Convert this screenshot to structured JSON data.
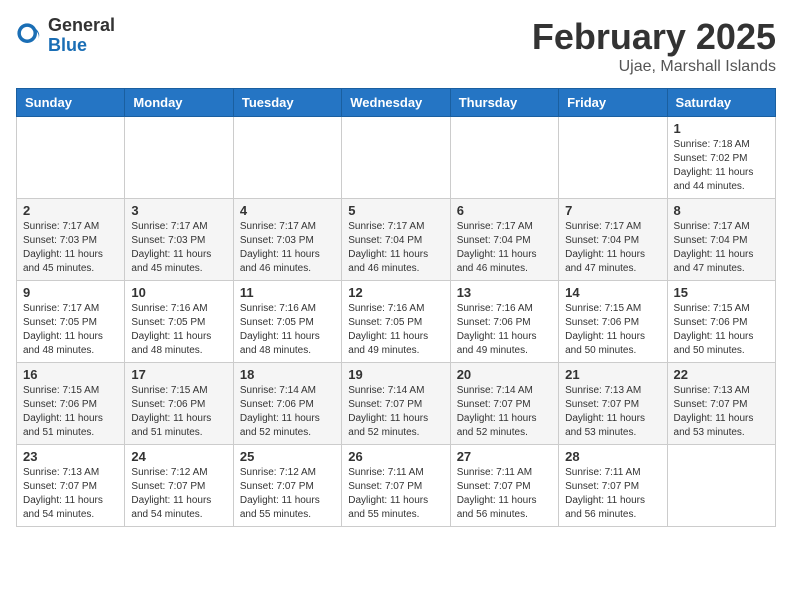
{
  "logo": {
    "general": "General",
    "blue": "Blue"
  },
  "title": "February 2025",
  "location": "Ujae, Marshall Islands",
  "days_of_week": [
    "Sunday",
    "Monday",
    "Tuesday",
    "Wednesday",
    "Thursday",
    "Friday",
    "Saturday"
  ],
  "weeks": [
    [
      {
        "day": "",
        "info": ""
      },
      {
        "day": "",
        "info": ""
      },
      {
        "day": "",
        "info": ""
      },
      {
        "day": "",
        "info": ""
      },
      {
        "day": "",
        "info": ""
      },
      {
        "day": "",
        "info": ""
      },
      {
        "day": "1",
        "info": "Sunrise: 7:18 AM\nSunset: 7:02 PM\nDaylight: 11 hours\nand 44 minutes."
      }
    ],
    [
      {
        "day": "2",
        "info": "Sunrise: 7:17 AM\nSunset: 7:03 PM\nDaylight: 11 hours\nand 45 minutes."
      },
      {
        "day": "3",
        "info": "Sunrise: 7:17 AM\nSunset: 7:03 PM\nDaylight: 11 hours\nand 45 minutes."
      },
      {
        "day": "4",
        "info": "Sunrise: 7:17 AM\nSunset: 7:03 PM\nDaylight: 11 hours\nand 46 minutes."
      },
      {
        "day": "5",
        "info": "Sunrise: 7:17 AM\nSunset: 7:04 PM\nDaylight: 11 hours\nand 46 minutes."
      },
      {
        "day": "6",
        "info": "Sunrise: 7:17 AM\nSunset: 7:04 PM\nDaylight: 11 hours\nand 46 minutes."
      },
      {
        "day": "7",
        "info": "Sunrise: 7:17 AM\nSunset: 7:04 PM\nDaylight: 11 hours\nand 47 minutes."
      },
      {
        "day": "8",
        "info": "Sunrise: 7:17 AM\nSunset: 7:04 PM\nDaylight: 11 hours\nand 47 minutes."
      }
    ],
    [
      {
        "day": "9",
        "info": "Sunrise: 7:17 AM\nSunset: 7:05 PM\nDaylight: 11 hours\nand 48 minutes."
      },
      {
        "day": "10",
        "info": "Sunrise: 7:16 AM\nSunset: 7:05 PM\nDaylight: 11 hours\nand 48 minutes."
      },
      {
        "day": "11",
        "info": "Sunrise: 7:16 AM\nSunset: 7:05 PM\nDaylight: 11 hours\nand 48 minutes."
      },
      {
        "day": "12",
        "info": "Sunrise: 7:16 AM\nSunset: 7:05 PM\nDaylight: 11 hours\nand 49 minutes."
      },
      {
        "day": "13",
        "info": "Sunrise: 7:16 AM\nSunset: 7:06 PM\nDaylight: 11 hours\nand 49 minutes."
      },
      {
        "day": "14",
        "info": "Sunrise: 7:15 AM\nSunset: 7:06 PM\nDaylight: 11 hours\nand 50 minutes."
      },
      {
        "day": "15",
        "info": "Sunrise: 7:15 AM\nSunset: 7:06 PM\nDaylight: 11 hours\nand 50 minutes."
      }
    ],
    [
      {
        "day": "16",
        "info": "Sunrise: 7:15 AM\nSunset: 7:06 PM\nDaylight: 11 hours\nand 51 minutes."
      },
      {
        "day": "17",
        "info": "Sunrise: 7:15 AM\nSunset: 7:06 PM\nDaylight: 11 hours\nand 51 minutes."
      },
      {
        "day": "18",
        "info": "Sunrise: 7:14 AM\nSunset: 7:06 PM\nDaylight: 11 hours\nand 52 minutes."
      },
      {
        "day": "19",
        "info": "Sunrise: 7:14 AM\nSunset: 7:07 PM\nDaylight: 11 hours\nand 52 minutes."
      },
      {
        "day": "20",
        "info": "Sunrise: 7:14 AM\nSunset: 7:07 PM\nDaylight: 11 hours\nand 52 minutes."
      },
      {
        "day": "21",
        "info": "Sunrise: 7:13 AM\nSunset: 7:07 PM\nDaylight: 11 hours\nand 53 minutes."
      },
      {
        "day": "22",
        "info": "Sunrise: 7:13 AM\nSunset: 7:07 PM\nDaylight: 11 hours\nand 53 minutes."
      }
    ],
    [
      {
        "day": "23",
        "info": "Sunrise: 7:13 AM\nSunset: 7:07 PM\nDaylight: 11 hours\nand 54 minutes."
      },
      {
        "day": "24",
        "info": "Sunrise: 7:12 AM\nSunset: 7:07 PM\nDaylight: 11 hours\nand 54 minutes."
      },
      {
        "day": "25",
        "info": "Sunrise: 7:12 AM\nSunset: 7:07 PM\nDaylight: 11 hours\nand 55 minutes."
      },
      {
        "day": "26",
        "info": "Sunrise: 7:11 AM\nSunset: 7:07 PM\nDaylight: 11 hours\nand 55 minutes."
      },
      {
        "day": "27",
        "info": "Sunrise: 7:11 AM\nSunset: 7:07 PM\nDaylight: 11 hours\nand 56 minutes."
      },
      {
        "day": "28",
        "info": "Sunrise: 7:11 AM\nSunset: 7:07 PM\nDaylight: 11 hours\nand 56 minutes."
      },
      {
        "day": "",
        "info": ""
      }
    ]
  ]
}
